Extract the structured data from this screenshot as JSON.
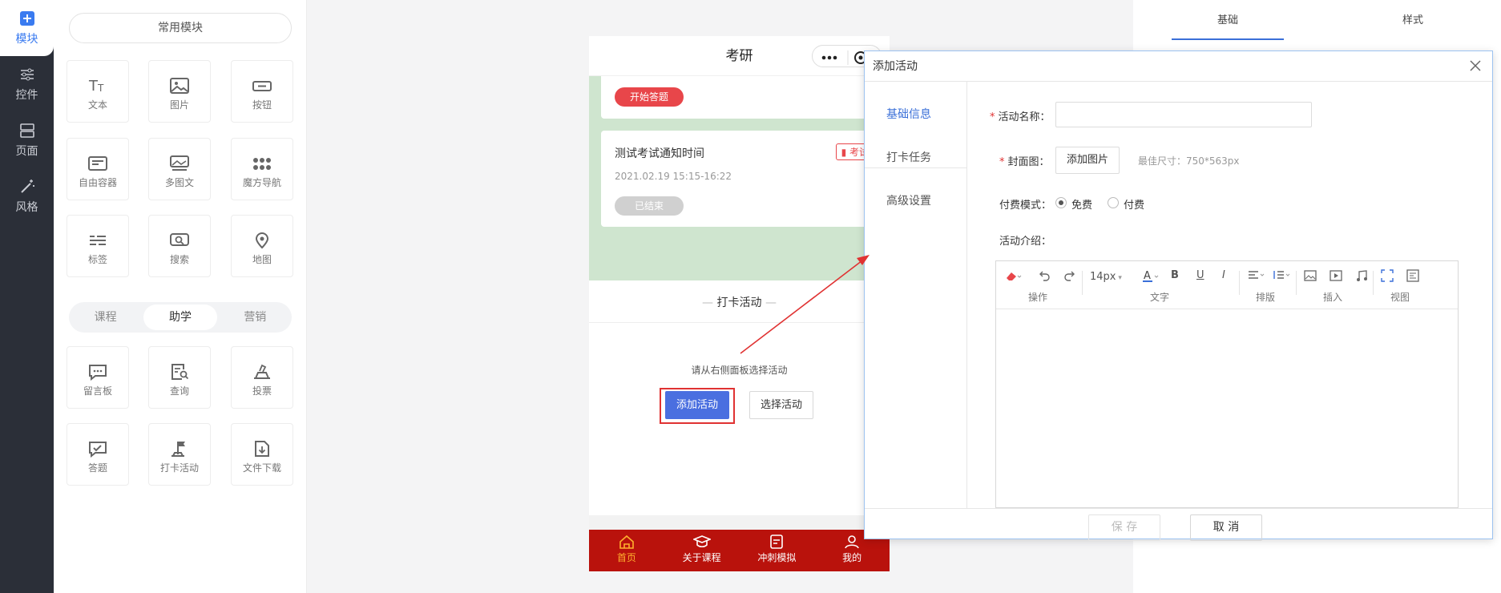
{
  "nav": {
    "items": [
      {
        "label": "模块",
        "icon": "plus-square-icon"
      },
      {
        "label": "控件",
        "icon": "sliders-icon"
      },
      {
        "label": "页面",
        "icon": "layout-icon"
      },
      {
        "label": "风格",
        "icon": "magic-wand-icon"
      }
    ]
  },
  "modules": {
    "common_label": "常用模块",
    "grid": [
      {
        "label": "文本",
        "icon": "text-icon"
      },
      {
        "label": "图片",
        "icon": "image-icon"
      },
      {
        "label": "按钮",
        "icon": "button-icon"
      },
      {
        "label": "自由容器",
        "icon": "container-icon"
      },
      {
        "label": "多图文",
        "icon": "multi-image-text-icon"
      },
      {
        "label": "魔方导航",
        "icon": "dots-grid-icon"
      },
      {
        "label": "标签",
        "icon": "tag-icon"
      },
      {
        "label": "搜索",
        "icon": "search-icon"
      },
      {
        "label": "地图",
        "icon": "map-pin-icon"
      }
    ],
    "tabs": [
      "课程",
      "助学",
      "营销"
    ],
    "active_tab": "助学",
    "grid2": [
      {
        "label": "留言板",
        "icon": "message-board-icon"
      },
      {
        "label": "查询",
        "icon": "query-icon"
      },
      {
        "label": "投票",
        "icon": "vote-icon"
      },
      {
        "label": "答题",
        "icon": "answer-icon"
      },
      {
        "label": "打卡活动",
        "icon": "check-in-icon"
      },
      {
        "label": "文件下载",
        "icon": "file-download-icon"
      }
    ]
  },
  "phone": {
    "title": "考研",
    "card1_button": "开始答题",
    "card2": {
      "title": "测试考试通知时间",
      "badge": "考试",
      "date": "2021.02.19 15:15-16:22",
      "status": "已结束"
    },
    "checkin_title": "打卡活动",
    "hint": "请从右侧面板选择活动",
    "add_button": "添加活动",
    "select_button": "选择活动",
    "tabbar": [
      {
        "label": "首页",
        "icon": "home-icon"
      },
      {
        "label": "关于课程",
        "icon": "graduation-cap-icon"
      },
      {
        "label": "冲刺模拟",
        "icon": "document-icon"
      },
      {
        "label": "我的",
        "icon": "user-icon"
      }
    ]
  },
  "right_panel": {
    "tabs": [
      "基础",
      "样式"
    ]
  },
  "dialog": {
    "title": "添加活动",
    "side": [
      "基础信息",
      "打卡任务",
      "高级设置"
    ],
    "fields": {
      "name_label": "活动名称：",
      "cover_label": "封面图：",
      "cover_button": "添加图片",
      "cover_tip": "最佳尺寸：750*563px",
      "pay_label": "付费模式：",
      "pay_free": "免费",
      "pay_paid": "付费",
      "intro_label": "活动介绍："
    },
    "editor": {
      "font_size": "14px",
      "groups": [
        "操作",
        "文字",
        "排版",
        "插入",
        "视图"
      ]
    },
    "save": "保 存",
    "cancel": "取 消"
  },
  "colors": {
    "accent": "#3a6fd8",
    "danger": "#e03232",
    "tabbar": "#b9120c"
  }
}
